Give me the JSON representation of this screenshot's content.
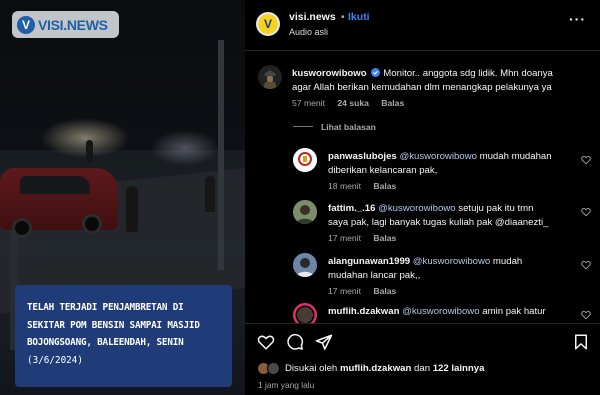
{
  "media": {
    "logo_mark": "V",
    "logo_text": "VISI.NEWS",
    "caption_lines": [
      "TELAH TERJADI PENJAMBRETAN DI",
      "SEKITAR POM BENSIN SAMPAI MASJID",
      "BOJONGSOANG, BALEENDAH, SENIN"
    ],
    "caption_date": "(3/6/2024)"
  },
  "post": {
    "avatar_letter": "V",
    "username": "visi.news",
    "separator": "•",
    "follow_label": "Ikuti",
    "audio_label": "Audio asli",
    "more_label": "···"
  },
  "comments": [
    {
      "username": "kusworowibowo",
      "verified": true,
      "text_line1": "Monitor.. anggota sdg lidik. Mhn doanya",
      "text_line2": "agar Allah berikan kemudahan dlm menangkap pelakunya ya",
      "time": "57 menit",
      "likes": "24 suka",
      "reply_label": "Balas",
      "view_replies_label": "Lihat balasan"
    },
    {
      "username": "panwaslubojes",
      "mention": "@kusworowibowo",
      "text_line1": " mudah mudahan",
      "text_line2": "diberikan kelancaran pak,",
      "time": "18 menit",
      "reply_label": "Balas"
    },
    {
      "username": "fattim._.16",
      "mention": "@kusworowibowo",
      "text_line1": " setuju pak itu tmn",
      "text_line2": "saya pak, lagi banyak tugas kuliah pak @diaanezti_",
      "time": "17 menit",
      "reply_label": "Balas"
    },
    {
      "username": "alangunawan1999",
      "mention": "@kusworowibowo",
      "text_line1": " mudah",
      "text_line2": "mudahan lancar pak,,",
      "time": "17 menit",
      "reply_label": "Balas"
    },
    {
      "username": "muflih.dzakwan",
      "mention": "@kusworowibowo",
      "text_line1": " amin pak hatur",
      "text_line2": ""
    }
  ],
  "footer": {
    "liked_by_prefix": "Disukai oleh ",
    "liked_by_user": "muflih.dzakwan",
    "liked_by_mid": " dan ",
    "liked_by_count": "122 lainnya",
    "time_ago": "1 jam yang lalu"
  },
  "icons": {
    "heart": "heart-icon",
    "comment": "comment-icon",
    "share": "share-icon",
    "bookmark": "bookmark-icon"
  },
  "colors": {
    "accent_blue": "#3b82f6",
    "caption_bg": "#1f3b78",
    "background": "#000000"
  }
}
